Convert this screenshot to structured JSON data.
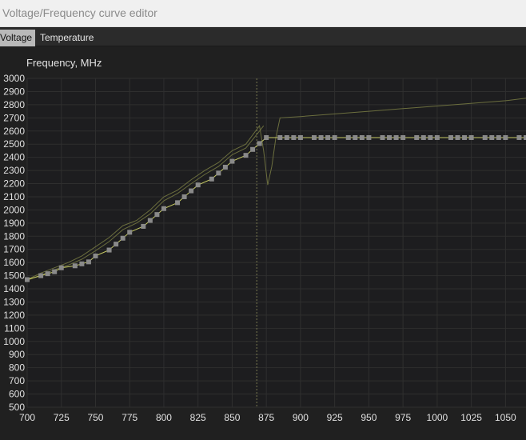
{
  "window": {
    "title": "Voltage/Frequency curve editor"
  },
  "tabs": [
    {
      "label": "Voltage",
      "active": true
    },
    {
      "label": "Temperature",
      "active": false
    }
  ],
  "colors": {
    "background": "#1d1d1f",
    "grid": "#2f2f2f",
    "curve": "#c8cc64",
    "offset_curve": "#6b6e3e",
    "points": "#8a8a8a",
    "marker_line": "#7a7a50",
    "tick_text": "#e0e0e0"
  },
  "chart_data": {
    "type": "line",
    "ylabel": "Frequency, MHz",
    "xlim": [
      700,
      1065
    ],
    "ylim": [
      500,
      3000
    ],
    "x_ticks": [
      "700",
      "725",
      "750",
      "775",
      "800",
      "825",
      "850",
      "875",
      "900",
      "925",
      "950",
      "975",
      "1000",
      "1025",
      "1050"
    ],
    "y_ticks": [
      "500",
      "600",
      "700",
      "800",
      "900",
      "1000",
      "1100",
      "1200",
      "1300",
      "1400",
      "1500",
      "1600",
      "1700",
      "1800",
      "1900",
      "2000",
      "2100",
      "2200",
      "2300",
      "2400",
      "2500",
      "2600",
      "2700",
      "2800",
      "2900",
      "3000"
    ],
    "grid": true,
    "current_voltage_marker": 868,
    "series": [
      {
        "role": "curve_points",
        "x": [
          700,
          710,
          715,
          720,
          725,
          735,
          740,
          745,
          750,
          760,
          765,
          770,
          775,
          785,
          790,
          795,
          800,
          810,
          815,
          820,
          825,
          835,
          840,
          845,
          850,
          860,
          865,
          870,
          875,
          885,
          890,
          895,
          900,
          910,
          915,
          920,
          925,
          935,
          940,
          945,
          950,
          960,
          965,
          970,
          975,
          985,
          990,
          995,
          1000,
          1010,
          1015,
          1020,
          1025,
          1035,
          1040,
          1045,
          1050,
          1060,
          1065
        ],
        "y": [
          1470,
          1500,
          1515,
          1530,
          1560,
          1575,
          1590,
          1605,
          1650,
          1695,
          1740,
          1785,
          1830,
          1875,
          1920,
          1965,
          2010,
          2055,
          2100,
          2145,
          2190,
          2235,
          2280,
          2325,
          2370,
          2415,
          2460,
          2505,
          2550,
          2550,
          2550,
          2550,
          2550,
          2550,
          2550,
          2550,
          2550,
          2550,
          2550,
          2550,
          2550,
          2550,
          2550,
          2550,
          2550,
          2550,
          2550,
          2550,
          2550,
          2550,
          2550,
          2550,
          2550,
          2550,
          2550,
          2550,
          2550,
          2550,
          2550
        ]
      },
      {
        "role": "upper_curve",
        "x": [
          700,
          710,
          720,
          730,
          740,
          750,
          760,
          770,
          780,
          790,
          800,
          810,
          820,
          830,
          840,
          850,
          860,
          870,
          873,
          876,
          879,
          882,
          885,
          900,
          950,
          1000,
          1050,
          1065
        ],
        "y": [
          1470,
          1520,
          1560,
          1600,
          1650,
          1720,
          1790,
          1880,
          1920,
          2000,
          2100,
          2150,
          2230,
          2300,
          2360,
          2450,
          2500,
          2640,
          2450,
          2190,
          2330,
          2550,
          2700,
          2710,
          2750,
          2790,
          2830,
          2850
        ]
      },
      {
        "role": "lower_curve",
        "x": [
          700,
          710,
          720,
          730,
          740,
          750,
          760,
          770,
          780,
          790,
          800,
          810,
          820,
          830,
          840,
          850,
          860,
          870,
          873
        ],
        "y": [
          1465,
          1505,
          1545,
          1580,
          1625,
          1690,
          1760,
          1850,
          1900,
          1970,
          2070,
          2125,
          2200,
          2270,
          2330,
          2420,
          2470,
          2600,
          2640
        ]
      }
    ]
  }
}
